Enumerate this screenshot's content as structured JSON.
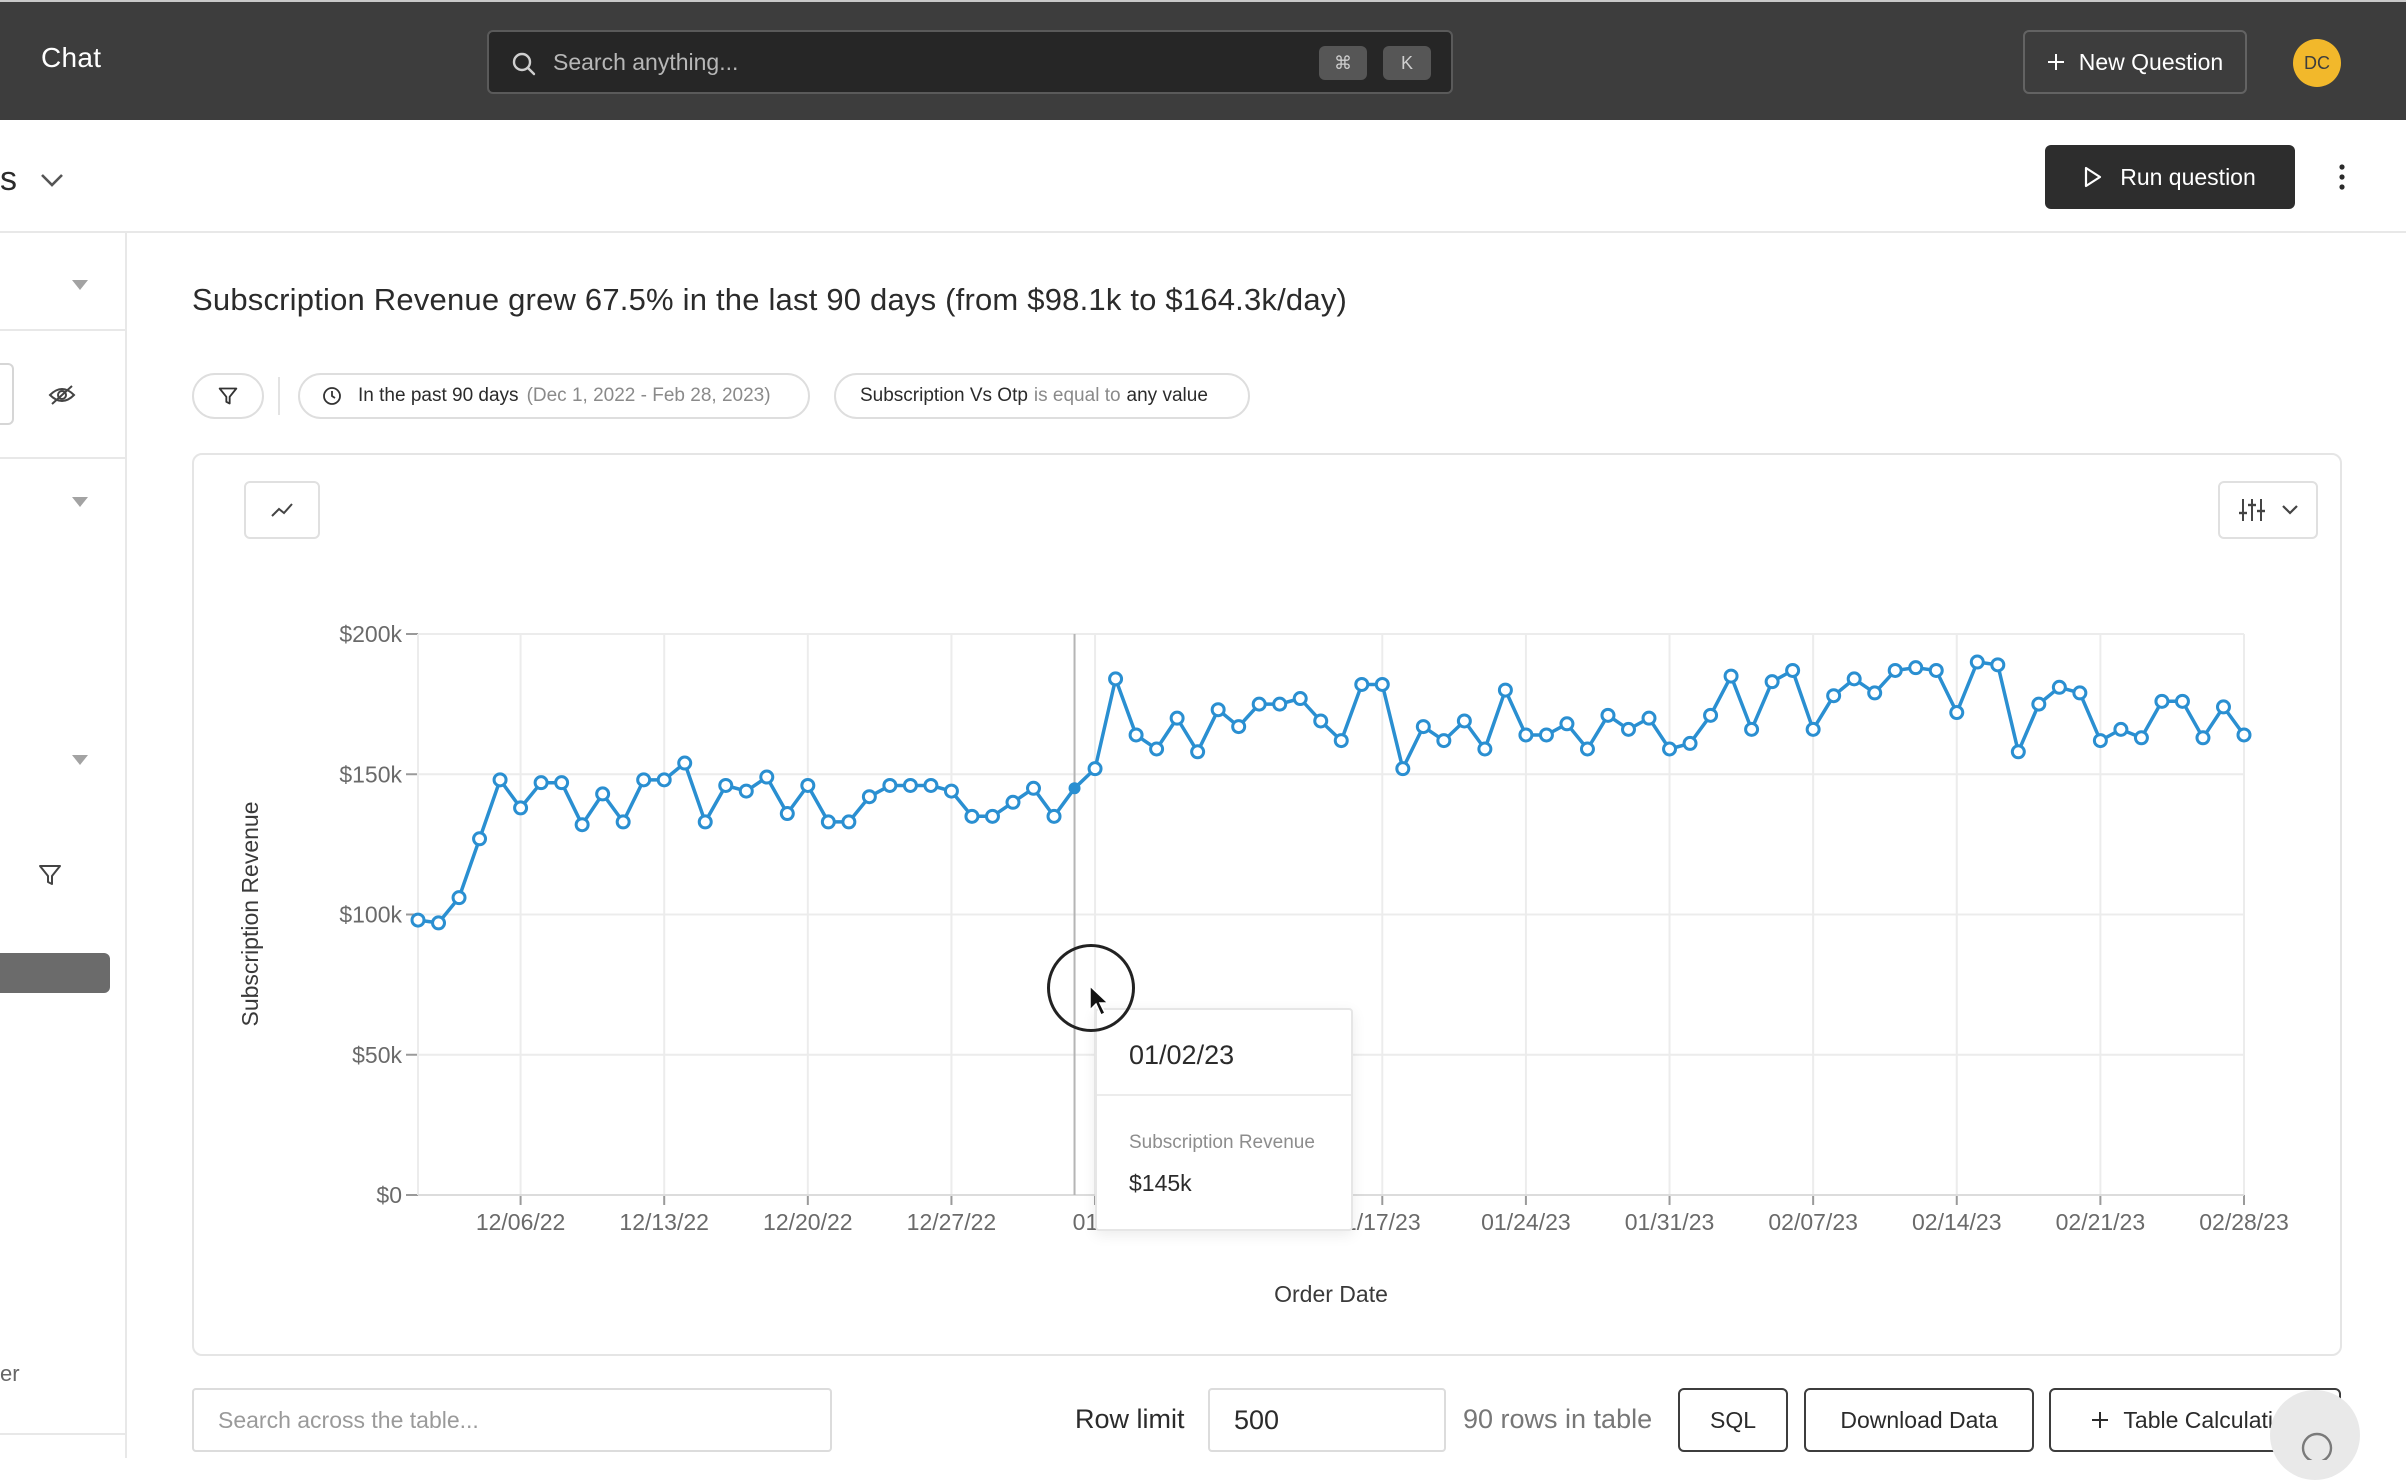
{
  "topbar": {
    "title": "Chat",
    "search_placeholder": "Search anything...",
    "kbd_cmd": "⌘",
    "kbd_k": "K",
    "new_question": "New Question",
    "avatar_initials": "DC"
  },
  "subheader": {
    "question_name_tail": "s",
    "run_label": "Run question"
  },
  "sidebar": {
    "trailing_text": "er"
  },
  "main": {
    "title": "Subscription Revenue grew 67.5% in the last 90 days (from $98.1k to $164.3k/day)",
    "filters": {
      "date_label": "In the past 90 days",
      "date_range": "(Dec 1, 2022 - Feb 28, 2023)",
      "field": "Subscription Vs Otp",
      "operator": "is equal to",
      "value": "any value"
    }
  },
  "chart_data": {
    "type": "line",
    "xlabel": "Order Date",
    "ylabel": "Subscription Revenue",
    "ylim": [
      0,
      200000
    ],
    "y_ticks": [
      "$0",
      "$50k",
      "$100k",
      "$150k",
      "$200k"
    ],
    "x_ticks": [
      "12/06/22",
      "12/13/22",
      "12/20/22",
      "12/27/22",
      "01/0",
      "1/17/23",
      "01/24/23",
      "01/31/23",
      "02/07/23",
      "02/14/23",
      "02/21/23",
      "02/28/23"
    ],
    "x_start": "2022-12-01",
    "x_end": "2023-02-28",
    "grid": true,
    "color": "#2a8fd1",
    "series": [
      {
        "name": "Subscription Revenue",
        "values": [
          98000,
          97000,
          106000,
          127000,
          148000,
          138000,
          147000,
          147000,
          132000,
          143000,
          133000,
          148000,
          148000,
          154000,
          133000,
          146000,
          144000,
          149000,
          136000,
          146000,
          133000,
          133000,
          142000,
          146000,
          146000,
          146000,
          144000,
          135000,
          135000,
          140000,
          145000,
          135000,
          145000,
          152000,
          184000,
          164000,
          159000,
          170000,
          158000,
          173000,
          167000,
          175000,
          175000,
          177000,
          169000,
          162000,
          182000,
          182000,
          152000,
          167000,
          162000,
          169000,
          159000,
          180000,
          164000,
          164000,
          168000,
          159000,
          171000,
          166000,
          170000,
          159000,
          161000,
          171000,
          185000,
          166000,
          183000,
          187000,
          166000,
          178000,
          184000,
          179000,
          187000,
          188000,
          187000,
          172000,
          190000,
          189000,
          158000,
          175000,
          181000,
          179000,
          162000,
          166000,
          163000,
          176000,
          176000,
          163000,
          174000,
          164000
        ]
      }
    ],
    "hover": {
      "date": "01/02/23",
      "series": "Subscription Revenue",
      "value": "$145k"
    }
  },
  "table_controls": {
    "search_placeholder": "Search across the table...",
    "row_limit_label": "Row limit",
    "row_limit_value": "500",
    "row_count": "90 rows in table",
    "sql": "SQL",
    "download": "Download Data",
    "table_calc": "Table Calculation"
  }
}
